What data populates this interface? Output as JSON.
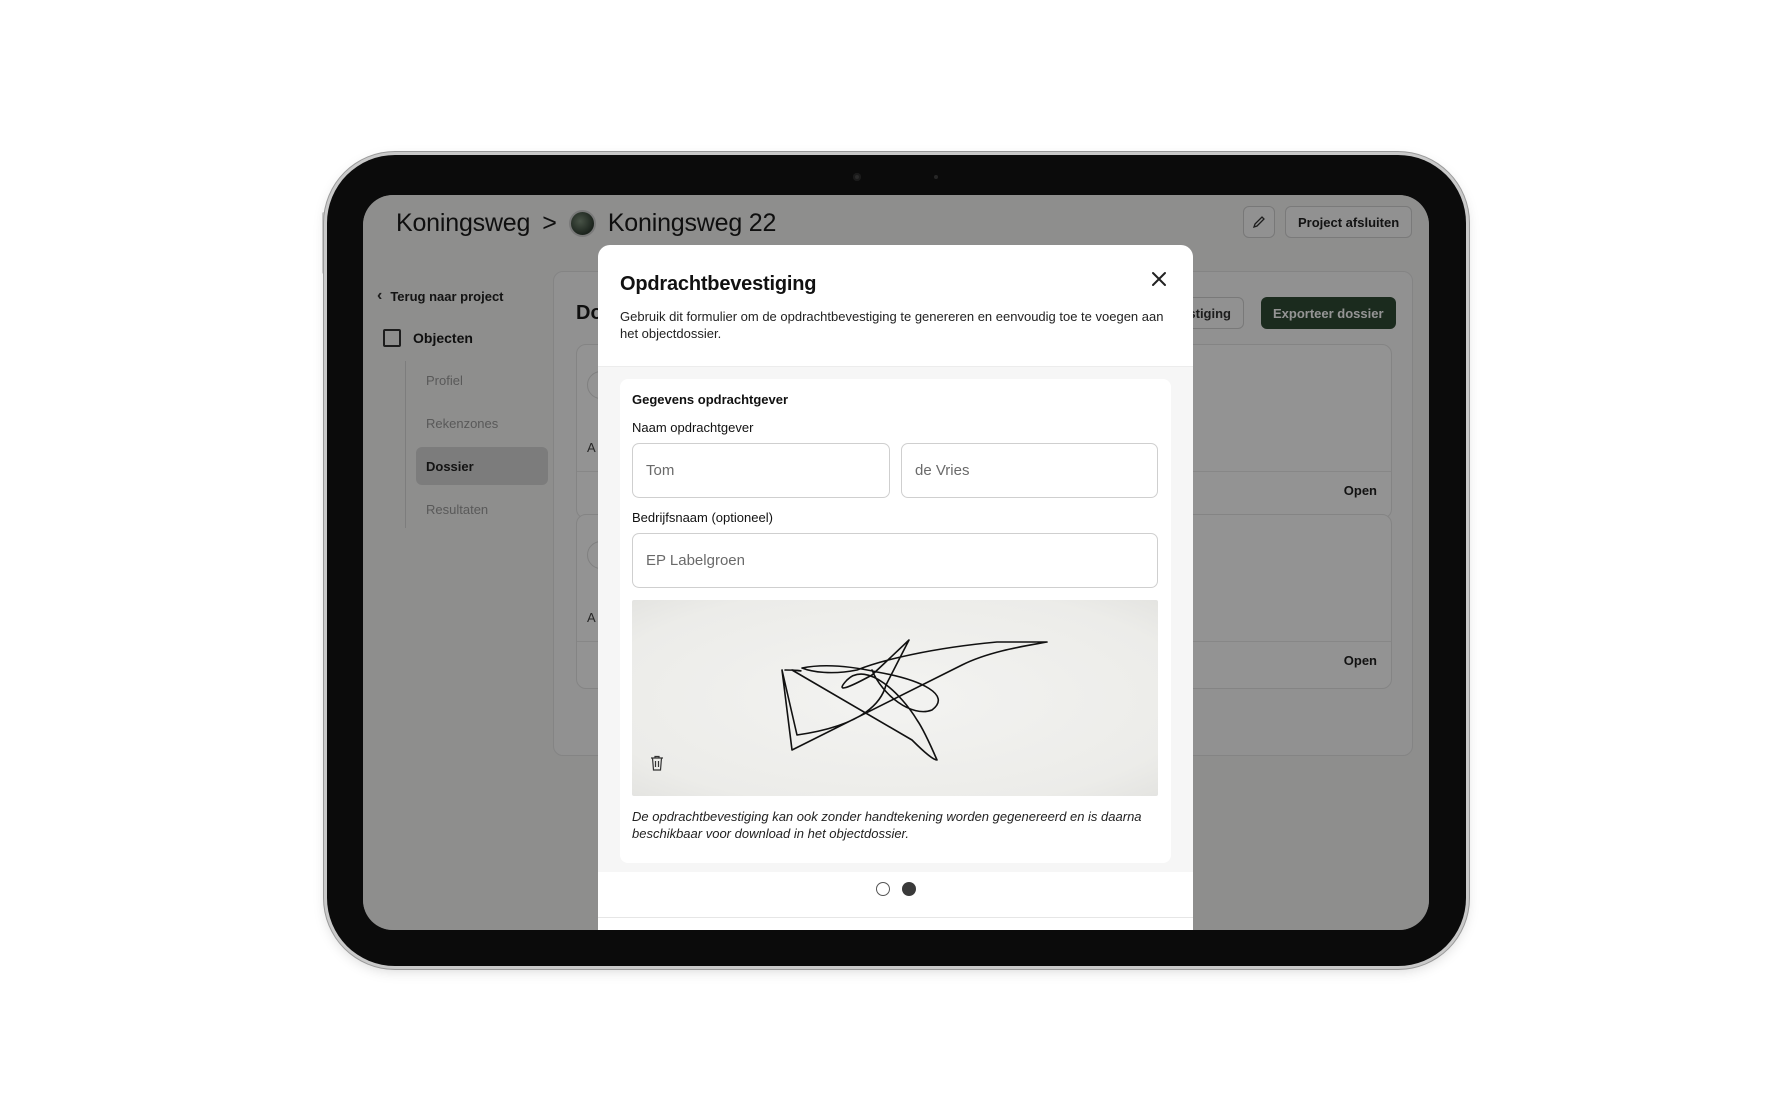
{
  "header": {
    "breadcrumb_project": "Koningsweg",
    "breadcrumb_separator": ">",
    "breadcrumb_object": "Koningsweg 22",
    "close_project_label": "Project afsluiten"
  },
  "sidebar": {
    "back_label": "Terug naar project",
    "section_label": "Objecten",
    "items": [
      {
        "label": "Profiel"
      },
      {
        "label": "Rekenzones"
      },
      {
        "label": "Dossier"
      },
      {
        "label": "Resultaten"
      }
    ],
    "active_item": "Dossier"
  },
  "main": {
    "title_partial": "Do",
    "button_partial": "estiging",
    "export_label": "Exporteer dossier",
    "cards": [
      {
        "prefix": "A",
        "action": "Open"
      },
      {
        "prefix": "A",
        "action": "Open"
      }
    ]
  },
  "modal": {
    "title": "Opdrachtbevestiging",
    "description": "Gebruik dit formulier om de opdrachtbevestiging te genereren en eenvoudig toe te voegen aan het objectdossier.",
    "section_title": "Gegevens opdrachtgever",
    "name_label": "Naam opdrachtgever",
    "first_name_value": "Tom",
    "last_name_value": "de Vries",
    "company_label": "Bedrijfsnaam (optioneel)",
    "company_value": "EP Labelgroen",
    "note": "De opdrachtbevestiging kan ook zonder handtekening worden gegenereerd en is daarna beschikbaar voor download in het objectdossier.",
    "steps_total": 2,
    "current_step": 2
  },
  "icons": {
    "edit": "pencil-icon",
    "close": "close-icon",
    "delete_signature": "trash-icon",
    "back": "chevron-left-icon",
    "objects": "building-icon"
  },
  "colors": {
    "accent_dark_green": "#2f4a35",
    "overlay": "rgba(0,0,0,0.42)"
  }
}
